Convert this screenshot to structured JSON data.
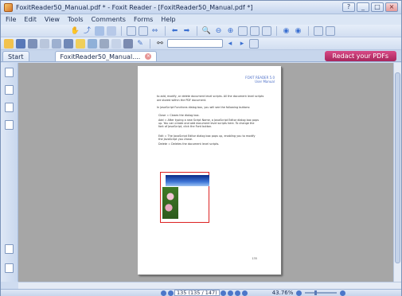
{
  "window": {
    "title": "FoxitReader50_Manual.pdf * - Foxit Reader - [FoxitReader50_Manual.pdf *]"
  },
  "menu": [
    "File",
    "Edit",
    "View",
    "Tools",
    "Comments",
    "Forms",
    "Help"
  ],
  "tabs": [
    {
      "label": "Start"
    },
    {
      "label": "FoxitReader50_Manual...."
    }
  ],
  "promo": {
    "label": "Redact your PDFs"
  },
  "document": {
    "header_lines": [
      "FOXIT READER 5.0",
      "User Manual"
    ],
    "intro": "to add, modify, or delete document level scripts. All the document level scripts are stored within the PDF document.",
    "intro2": "In JavaScript Functions dialog box, you will see the following buttons:",
    "bullets": [
      "Close = Closes the dialog box.",
      "Add = After typing a new Script Name, a JavaScript Editor dialog box pops up. You can create and add document level scripts here. To change the font of JavaScript, click the Font button.",
      "Edit = The JavaScript Editor dialog box pops up, enabling you to modify the JavaScript you chose.",
      "Delete = Deletes the document level scripts."
    ],
    "page_number": "135"
  },
  "status": {
    "page_display": "135 (135 / 147)",
    "zoom": "43.76%"
  },
  "colors": {
    "accent": "#4c77c9",
    "promo": "#c03872",
    "page_bg": "#a6a6a6"
  }
}
